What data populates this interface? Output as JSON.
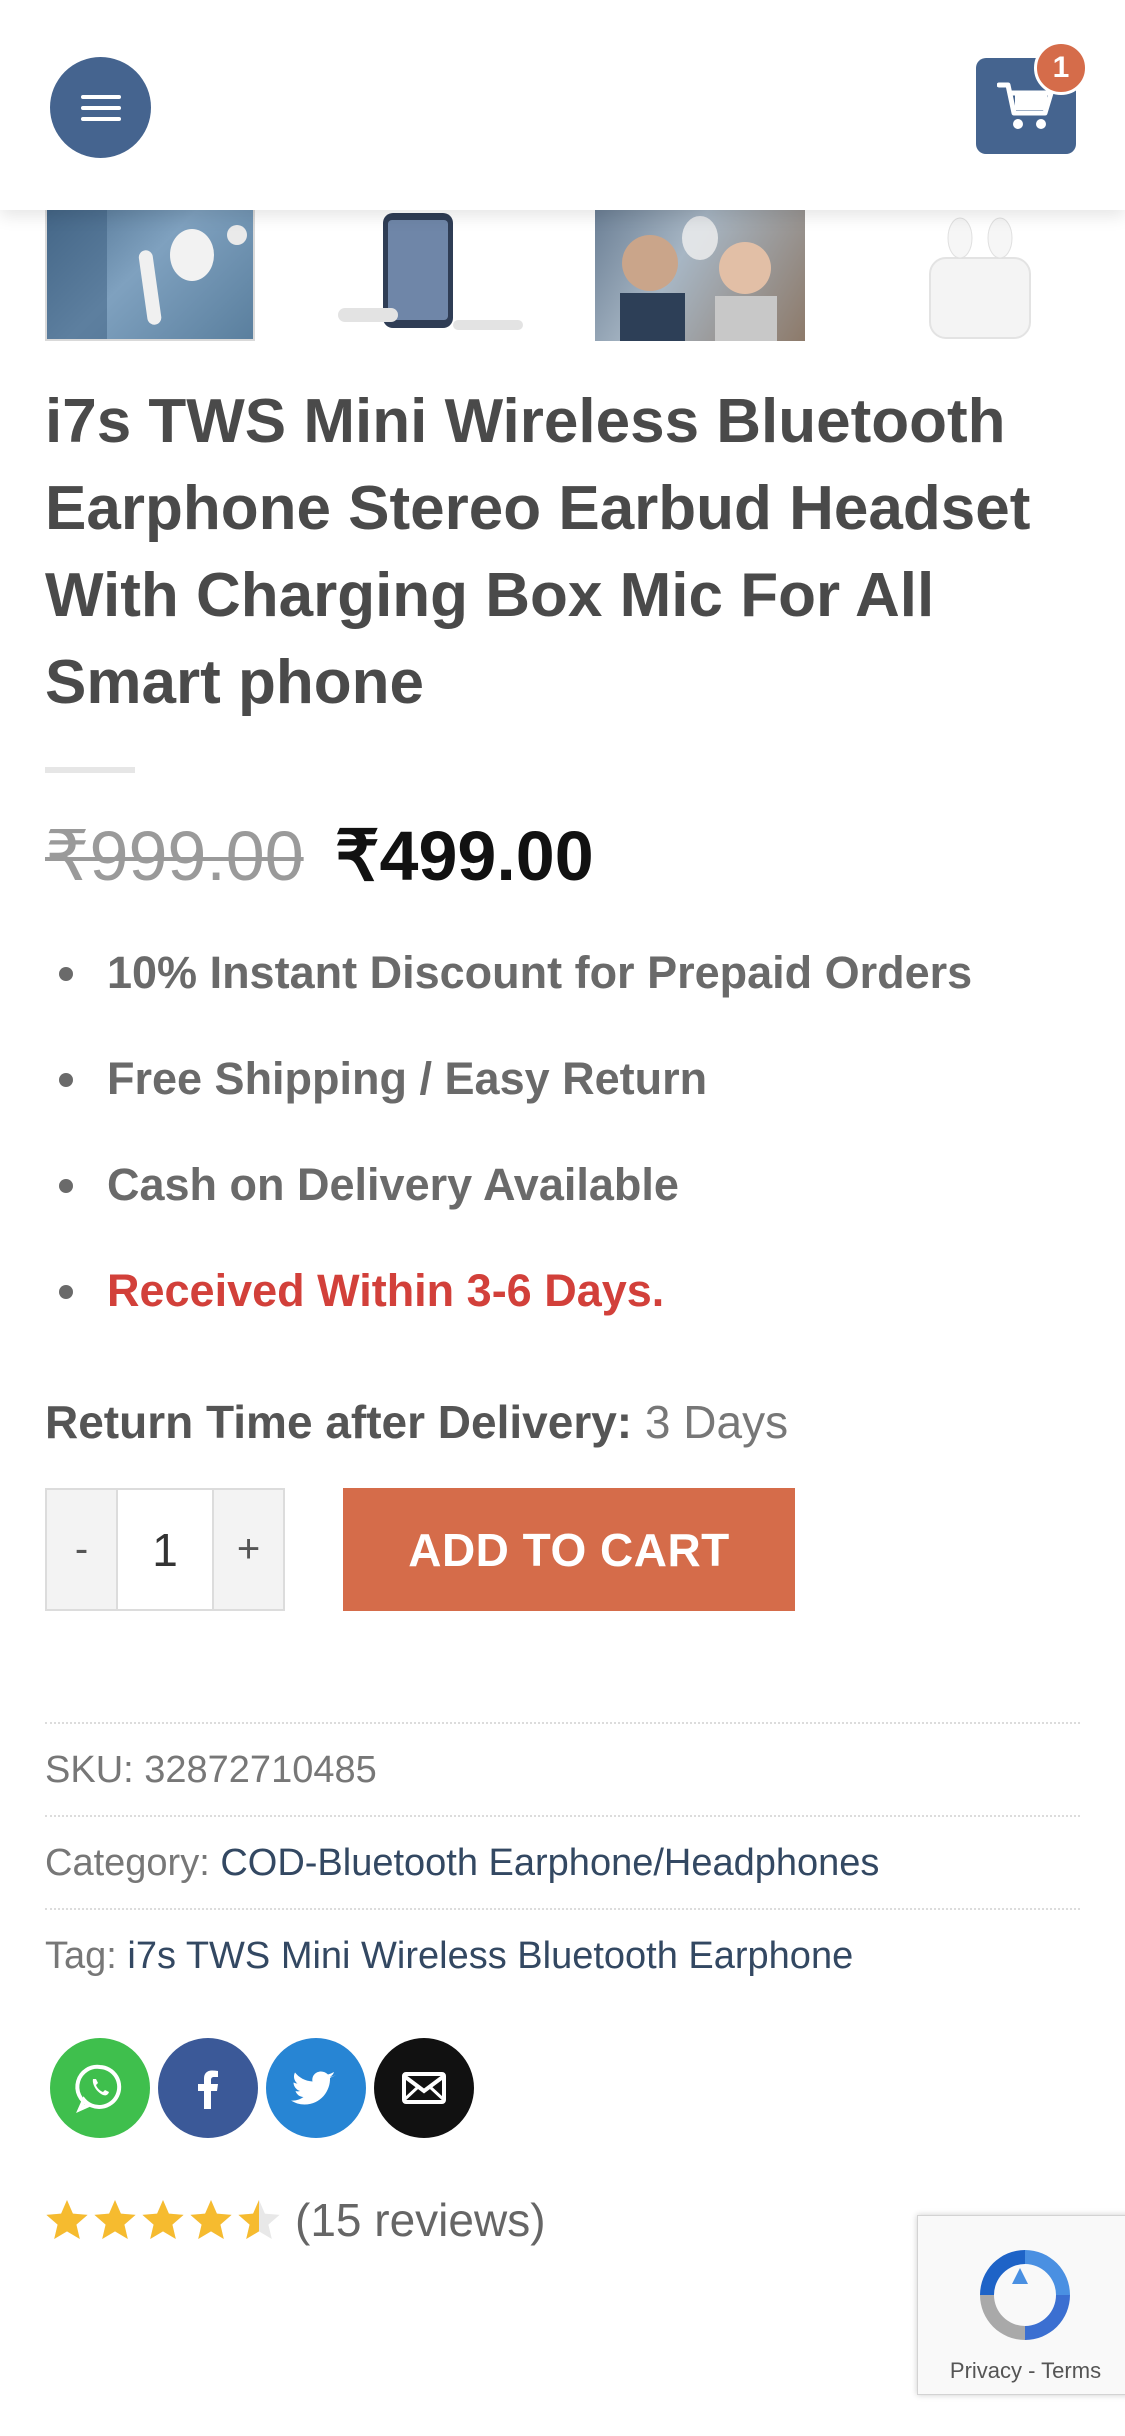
{
  "header": {
    "menu_icon": "hamburger-menu-icon",
    "cart_icon": "shopping-cart-icon",
    "cart_count": "1",
    "accent_color": "#45648f"
  },
  "gallery": {
    "thumbnails": [
      "thumbnail-1",
      "thumbnail-2",
      "thumbnail-3",
      "thumbnail-4"
    ]
  },
  "product": {
    "title": "i7s TWS Mini Wireless Bluetooth Earphone Stereo Earbud Headset With Charging Box Mic For All Smart phone",
    "old_price": "₹999.00",
    "new_price": "₹499.00",
    "highlights": [
      "10% Instant Discount for Prepaid Orders",
      "Free Shipping / Easy Return",
      "Cash on Delivery Available",
      "Received Within 3-6 Days."
    ],
    "return_label": "Return Time after Delivery:",
    "return_value": "3 Days"
  },
  "cart_form": {
    "minus": "-",
    "quantity": "1",
    "plus": "+",
    "add_to_cart": "ADD TO CART",
    "button_color": "#d56c4a"
  },
  "meta": {
    "sku_label": "SKU:",
    "sku_value": "32872710485",
    "category_label": "Category:",
    "category_value": "COD-Bluetooth Earphone/Headphones",
    "tag_label": "Tag:",
    "tag_value": "i7s TWS Mini Wireless Bluetooth Earphone"
  },
  "share": {
    "icons": [
      "whatsapp-icon",
      "facebook-icon",
      "twitter-icon",
      "email-icon"
    ]
  },
  "rating": {
    "stars": 4.5,
    "max": 5,
    "reviews_text": "(15 reviews)",
    "star_color": "#f6bb2f"
  },
  "recaptcha": {
    "links": "Privacy - Terms"
  }
}
